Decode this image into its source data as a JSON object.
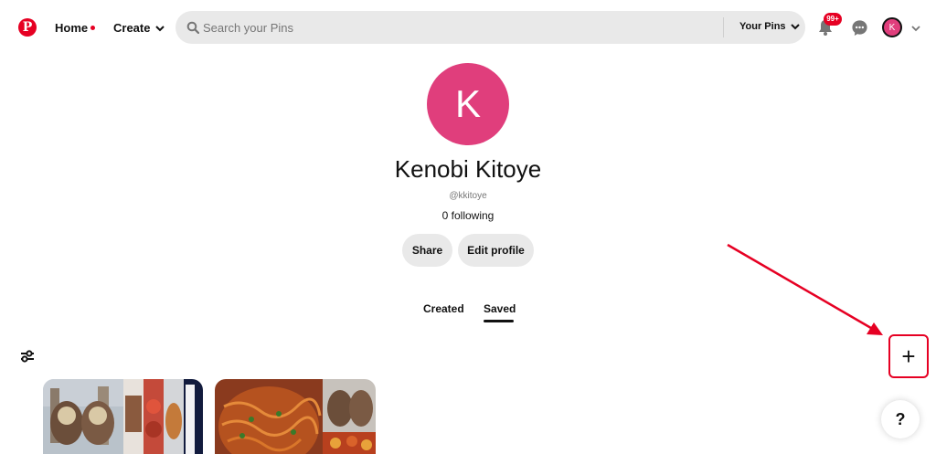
{
  "header": {
    "logo_icon": "pinterest-logo",
    "home_label": "Home",
    "create_label": "Create",
    "search_placeholder": "Search your Pins",
    "search_scope": "Your Pins",
    "notifications_badge": "99+",
    "account_initial": "K",
    "brand_color": "#e60023"
  },
  "profile": {
    "initial": "K",
    "name": "Kenobi Kitoye",
    "handle": "@kkitoye",
    "following": "0 following",
    "avatar_color": "#e03e7c",
    "share_label": "Share",
    "edit_label": "Edit profile"
  },
  "tabs": [
    {
      "label": "Created",
      "active": false
    },
    {
      "label": "Saved",
      "active": true
    }
  ],
  "actions": {
    "create_board_label": "+",
    "help_label": "?"
  }
}
